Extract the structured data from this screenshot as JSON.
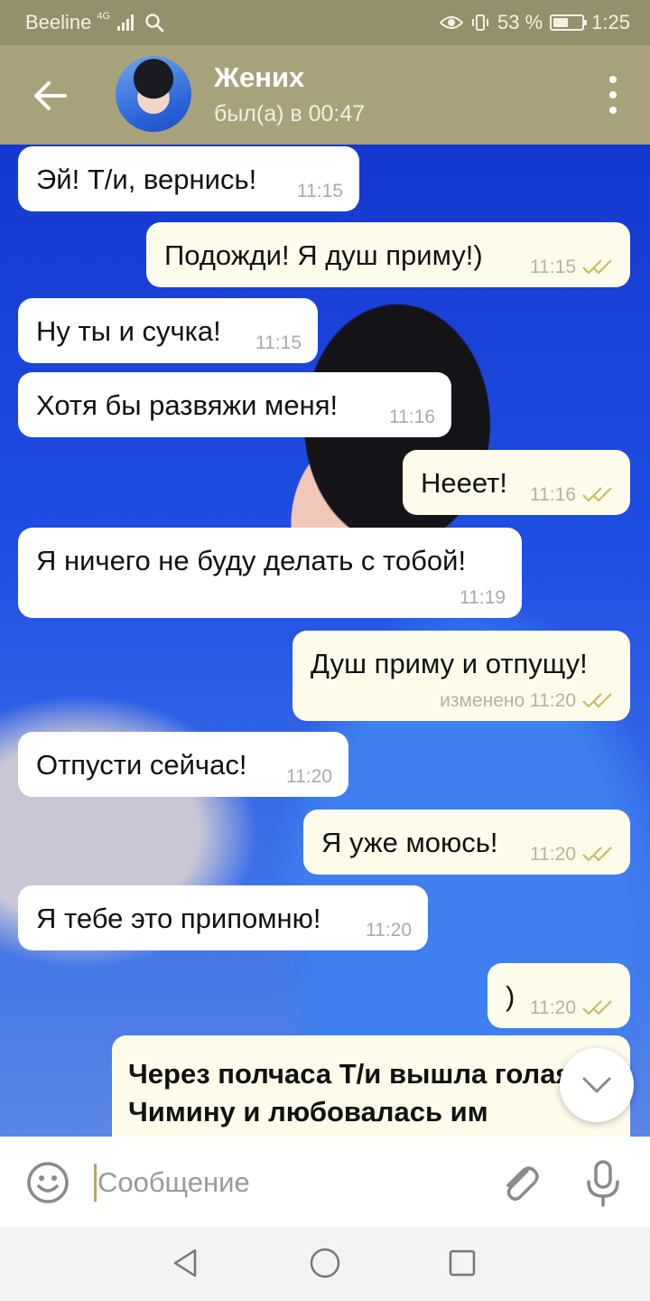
{
  "status": {
    "carrier": "Beeline",
    "network": "4G",
    "battery": "53 %",
    "battery_level": 0.53,
    "time": "1:25"
  },
  "header": {
    "contact_name": "Жених",
    "last_seen": "был(а) в 00:47"
  },
  "messages": [
    {
      "text": "Эй! Т/и, вернись!",
      "time": "11:15",
      "direction": "in"
    },
    {
      "text": "Подожди! Я душ приму!)",
      "time": "11:15",
      "direction": "out"
    },
    {
      "text": "Ну ты и сучка!",
      "time": "11:15",
      "direction": "in"
    },
    {
      "text": "Хотя бы развяжи меня!",
      "time": "11:16",
      "direction": "in"
    },
    {
      "text": "Нееет!",
      "time": "11:16",
      "direction": "out"
    },
    {
      "text": "Я ничего не буду делать с тобой!",
      "time": "11:19",
      "direction": "in"
    },
    {
      "text": "Душ приму и отпущу!",
      "time": "изменено 11:20",
      "direction": "out"
    },
    {
      "text": "Отпусти сейчас!",
      "time": "11:20",
      "direction": "in"
    },
    {
      "text": "Я уже моюсь!",
      "time": "11:20",
      "direction": "out"
    },
    {
      "text": "Я тебе это припомню!",
      "time": "11:20",
      "direction": "in"
    },
    {
      "text": ")",
      "time": "11:20",
      "direction": "out"
    }
  ],
  "story": {
    "text": "Через полчаса Т/и вышла голая к Чимину и любовалась им"
  },
  "input": {
    "placeholder": "Сообщение"
  },
  "colors": {
    "header": "#a8a27c",
    "status_bar": "#948f6c",
    "outgoing_bubble": "#fdfbe9",
    "incoming_bubble": "#ffffff",
    "check_marks": "#c8bb66"
  },
  "icons": {
    "back": "arrow-left",
    "menu": "kebab-vertical",
    "emoji": "smiley",
    "attach": "paperclip",
    "voice": "microphone",
    "scroll_down": "chevron-down"
  }
}
